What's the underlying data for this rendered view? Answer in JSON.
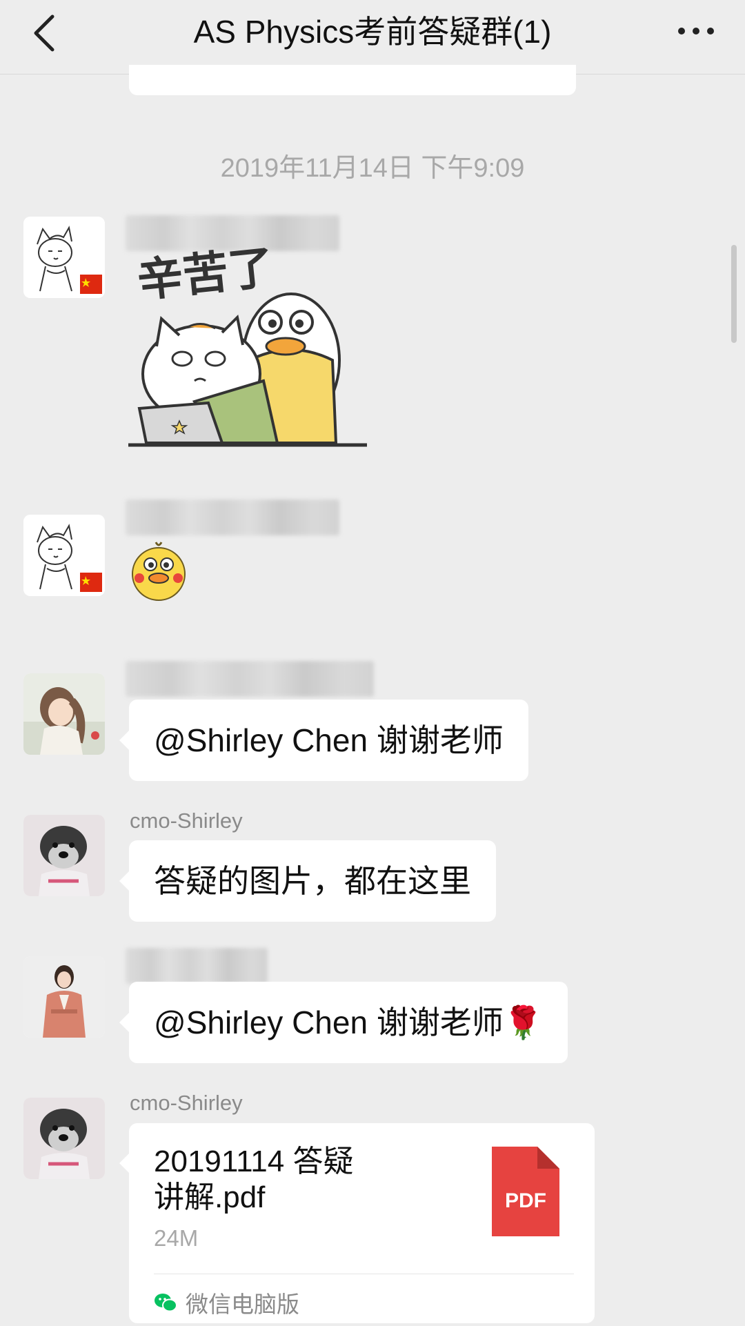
{
  "header": {
    "title": "AS Physics考前答疑群(1)",
    "back_icon": "chevron-left-icon",
    "more_icon": "more-dots-icon"
  },
  "timestamp": "2019年11月14日 下午9:09",
  "messages": [
    {
      "type": "sticker",
      "sticker_text": "辛苦了"
    },
    {
      "type": "sticker"
    },
    {
      "type": "text",
      "text": "@Shirley Chen 谢谢老师"
    },
    {
      "type": "text",
      "sender": "cmo-Shirley",
      "text": "答疑的图片，都在这里"
    },
    {
      "type": "text",
      "text": "@Shirley Chen 谢谢老师🌹"
    },
    {
      "type": "file",
      "sender": "cmo-Shirley",
      "file_name_line1": "20191114 答疑",
      "file_name_line2": "讲解.pdf",
      "file_size": "24M",
      "file_type": "PDF",
      "source": "微信电脑版"
    }
  ],
  "colors": {
    "background": "#ededed",
    "bubble": "#ffffff",
    "pdf_red": "#e64340",
    "wechat_green": "#07c160"
  }
}
